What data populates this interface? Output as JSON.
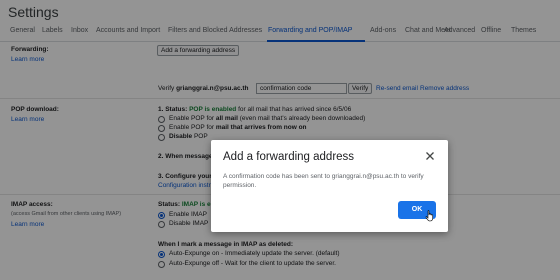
{
  "header": {
    "title": "Settings"
  },
  "tabs": [
    {
      "label": "General"
    },
    {
      "label": "Labels"
    },
    {
      "label": "Inbox"
    },
    {
      "label": "Accounts and Import"
    },
    {
      "label": "Filters and Blocked Addresses"
    },
    {
      "label": "Forwarding and POP/IMAP"
    },
    {
      "label": "Add-ons"
    },
    {
      "label": "Chat and Meet"
    },
    {
      "label": "Advanced"
    },
    {
      "label": "Offline"
    },
    {
      "label": "Themes"
    }
  ],
  "forwarding": {
    "label": "Forwarding:",
    "learn_more": "Learn more",
    "add_button": "Add a forwarding address",
    "verify_prefix": "Verify",
    "verify_email": "grianggrai.n@psu.ac.th",
    "code_placeholder": "confirmation code",
    "verify_button": "Verify",
    "resend": "Re-send email",
    "remove": "Remove address"
  },
  "pop": {
    "label": "POP download:",
    "learn_more": "Learn more",
    "status_prefix": "1. Status:",
    "status_value": "POP is enabled",
    "status_suffix": "for all mail that has arrived since 6/5/06",
    "opt1_prefix": "Enable POP for",
    "opt1_bold": "all mail",
    "opt1_suffix": "(even mail that's already been downloaded)",
    "opt2_prefix": "Enable POP for",
    "opt2_bold": "mail that arrives from now on",
    "opt3_prefix": "Disable",
    "opt3_bold": "POP",
    "step2": "2. When message",
    "step3": "3. Configure your",
    "config_link": "Configuration instr"
  },
  "imap": {
    "label": "IMAP access:",
    "sub": "(access Gmail from other clients using IMAP)",
    "learn_more": "Learn more",
    "status_prefix": "Status:",
    "status_value": "IMAP is e",
    "enable": "Enable IMAP",
    "disable": "Disable IMAP",
    "delete_heading": "When I mark a message in IMAP as deleted:",
    "expunge_on": "Auto-Expunge on - Immediately update the server. (default)",
    "expunge_off": "Auto-Expunge off - Wait for the client to update the server."
  },
  "dialog": {
    "title": "Add a forwarding address",
    "body": "A confirmation code has been sent to grianggrai.n@psu.ac.th to verify permission.",
    "ok": "OK",
    "close_icon": "close-icon"
  },
  "colors": {
    "accent": "#0b57d0",
    "ok_button": "#1a73e8",
    "enabled": "#188038"
  }
}
